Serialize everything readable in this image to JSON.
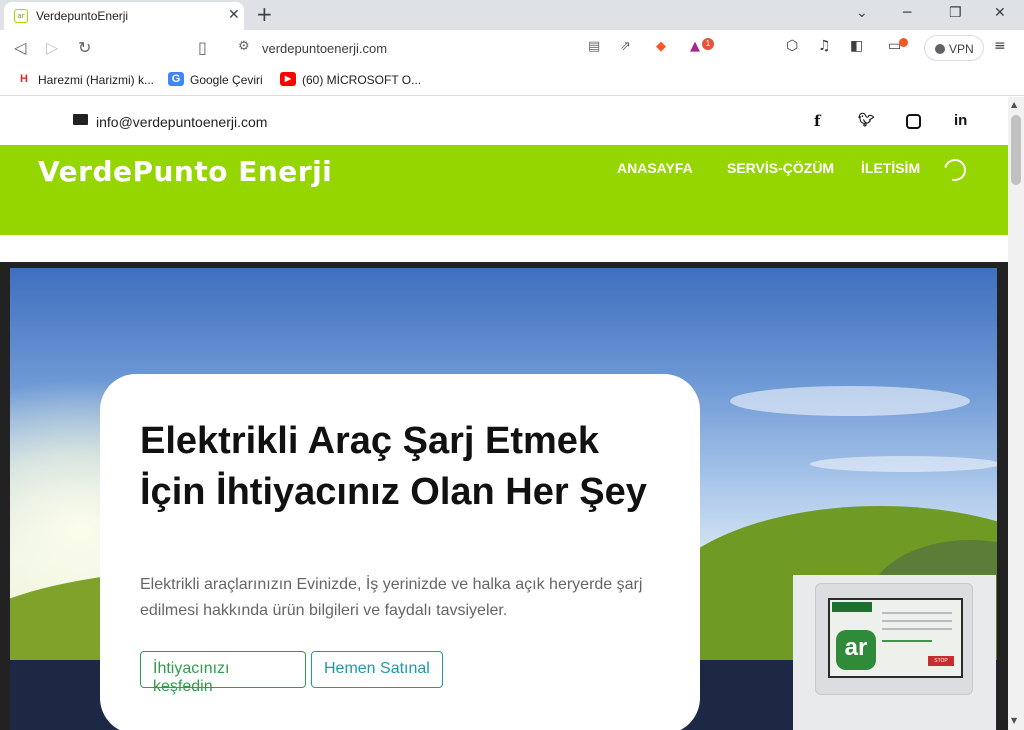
{
  "browser": {
    "tab_title": "VerdepuntoEnerji",
    "tab_favicon": "ar",
    "new_tab": "+",
    "url": "verdepuntoenerji.com",
    "vpn_label": "VPN",
    "brave_badge_count": "1",
    "bookmarks": [
      {
        "label": "Harezmi (Harizmi) k...",
        "icon": "H",
        "color": "#d93025"
      },
      {
        "label": "Google Çeviri",
        "icon": "G",
        "color": "#4285f4"
      },
      {
        "label": "(60) MİCROSOFT O...",
        "icon": "▶",
        "color": "#ff0000"
      }
    ]
  },
  "topbar": {
    "email": "info@verdepuntoenerji.com",
    "social": [
      "f",
      "t",
      "ig",
      "in"
    ]
  },
  "navbar": {
    "brand": "VerdePunto Enerji",
    "menu": [
      "ANASAYFA",
      "SERVİS-ÇÖZÜM",
      "İLETİSİM"
    ],
    "color": "#96d600"
  },
  "hero": {
    "title": "Elektrikli Araç Şarj Etmek İçin İhtiyacınız Olan Her Şey",
    "subtitle": "Elektrikli araçlarınızın Evinizde, İş yerinizde ve halka açık heryerde şarj edilmesi hakkında ürün bilgileri ve faydalı tavsiyeler.",
    "button_primary": "İhtiyacınızı keşfedin",
    "button_secondary": "Hemen Satınal"
  },
  "device": {
    "logo": "ar",
    "stop_label": "STOP"
  }
}
